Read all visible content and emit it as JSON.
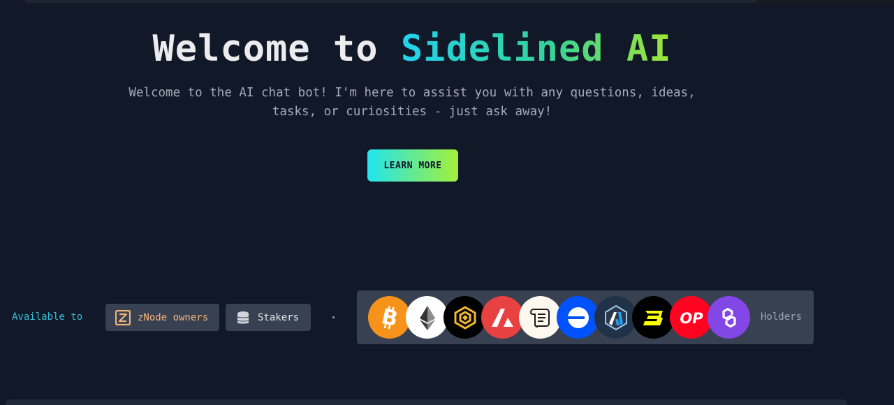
{
  "hero": {
    "title_prefix": "Welcome to ",
    "title_highlight": "Sidelined AI",
    "subtitle_line1": "Welcome to the AI chat bot! I'm here to assist you with any questions, ideas,",
    "subtitle_line2": "tasks, or curiosities - just ask away!",
    "cta_label": "LEARN MORE",
    "gradient_colors": [
      "#22d3ee",
      "#34d399",
      "#a3e635"
    ]
  },
  "availability": {
    "label": "Available to",
    "groups": [
      {
        "label": "zNode owners",
        "icon": "znode-icon",
        "color": "#f3b27a"
      },
      {
        "label": "Stakers",
        "icon": "database-icon",
        "color": "#e5e7eb"
      }
    ],
    "separator": "·",
    "tokens": [
      {
        "name": "bitcoin",
        "icon": "bitcoin-icon",
        "color": "#f7931a"
      },
      {
        "name": "ethereum",
        "icon": "ethereum-icon",
        "color": "#ffffff"
      },
      {
        "name": "bnb",
        "icon": "bnb-icon",
        "color": "#000000"
      },
      {
        "name": "avalanche",
        "icon": "avalanche-icon",
        "color": "#e84142"
      },
      {
        "name": "scroll",
        "icon": "scroll-icon",
        "color": "#fff8ee"
      },
      {
        "name": "base",
        "icon": "base-icon",
        "color": "#0052ff"
      },
      {
        "name": "arbitrum",
        "icon": "arbitrum-icon",
        "color": "#213147"
      },
      {
        "name": "blast",
        "icon": "blast-icon",
        "color": "#000000"
      },
      {
        "name": "optimism",
        "icon": "optimism-icon",
        "color": "#ff0420",
        "text": "OP"
      },
      {
        "name": "polygon",
        "icon": "polygon-icon",
        "color": "#8247e5"
      }
    ],
    "holders_label": "Holders"
  }
}
